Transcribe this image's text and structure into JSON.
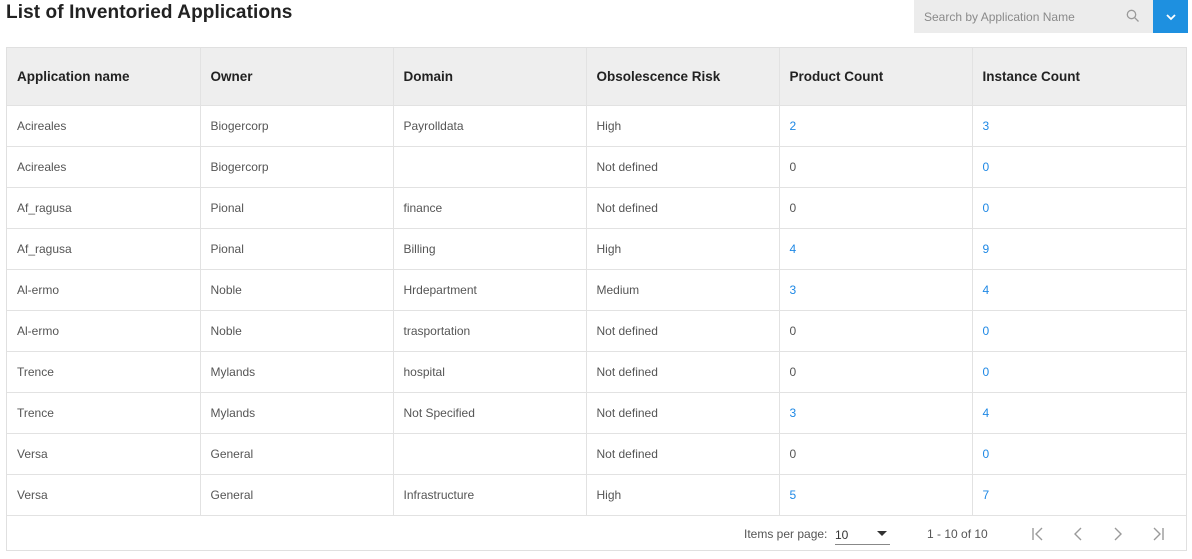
{
  "page": {
    "title": "List of Inventoried Applications"
  },
  "search": {
    "placeholder": "Search by Application Name",
    "value": ""
  },
  "colors": {
    "accent": "#1e90e0",
    "link": "#1e88e5",
    "header_bg": "#eeeeee"
  },
  "icons": {
    "search": "search-icon",
    "dropdown": "chevron-down-icon",
    "first": "first-page-icon",
    "prev": "chevron-left-icon",
    "next": "chevron-right-icon",
    "last": "last-page-icon"
  },
  "table": {
    "columns": [
      "Application name",
      "Owner",
      "Domain",
      "Obsolescence Risk",
      "Product Count",
      "Instance Count"
    ],
    "rows": [
      [
        "Acireales",
        "Biogercorp",
        "Payrolldata",
        "High",
        "2",
        "3"
      ],
      [
        "Acireales",
        "Biogercorp",
        "",
        "Not defined",
        "0",
        "0"
      ],
      [
        "Af_ragusa",
        "Pional",
        "finance",
        "Not defined",
        "0",
        "0"
      ],
      [
        "Af_ragusa",
        "Pional",
        "Billing",
        "High",
        "4",
        "9"
      ],
      [
        "Al-ermo",
        "Noble",
        "Hrdepartment",
        "Medium",
        "3",
        "4"
      ],
      [
        "Al-ermo",
        "Noble",
        "trasportation",
        "Not defined",
        "0",
        "0"
      ],
      [
        "Trence",
        "Mylands",
        "hospital",
        "Not defined",
        "0",
        "0"
      ],
      [
        "Trence",
        "Mylands",
        "Not Specified",
        "Not defined",
        "3",
        "4"
      ],
      [
        "Versa",
        "General",
        "",
        "Not defined",
        "0",
        "0"
      ],
      [
        "Versa",
        "General",
        "Infrastructure",
        "High",
        "5",
        "7"
      ]
    ]
  },
  "paginator": {
    "items_label": "Items per page:",
    "page_size": "10",
    "range_label": "1 - 10 of 10"
  }
}
